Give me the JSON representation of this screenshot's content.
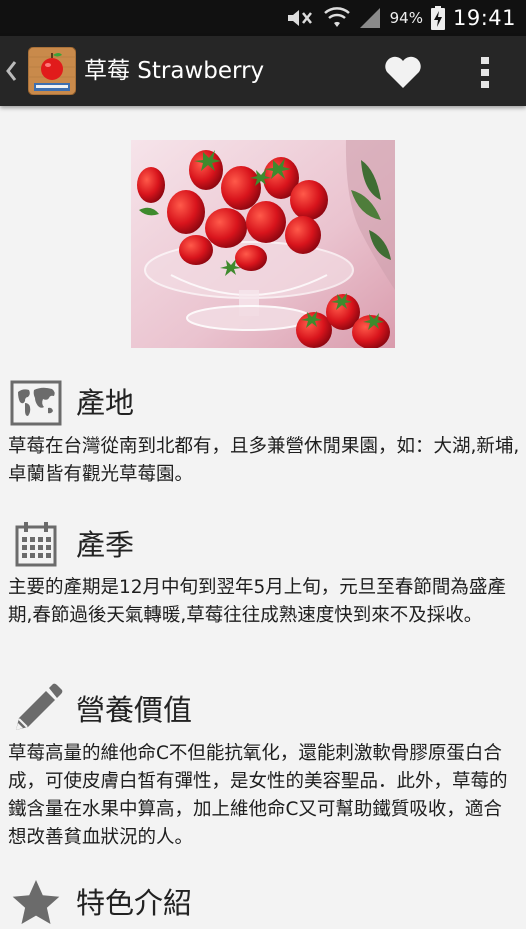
{
  "status_bar": {
    "battery_percent": "94%",
    "time": "19:41",
    "icons": [
      "mute-icon",
      "wifi-icon",
      "signal-icon",
      "battery-charging-icon"
    ]
  },
  "action_bar": {
    "title": "草莓 Strawberry",
    "icons": [
      "back-icon",
      "apple-book-app-icon",
      "heart-icon",
      "overflow-menu-icon"
    ]
  },
  "sections": [
    {
      "icon": "world-map-icon",
      "title": "產地",
      "body": "草莓在台灣從南到北都有，且多兼營休閒果園，如：大湖,新埔,卓蘭皆有觀光草莓園。"
    },
    {
      "icon": "calendar-icon",
      "title": "產季",
      "body": "主要的產期是12月中旬到翌年5月上旬，元旦至春節間為盛產期,春節過後天氣轉暖,草莓往往成熟速度快到來不及採收。"
    },
    {
      "icon": "pencil-icon",
      "title": "營養價值",
      "body": "草莓高量的維他命C不但能抗氧化，還能刺激軟骨膠原蛋白合成，可使皮膚白皙有彈性，是女性的美容聖品．此外，草莓的鐵含量在水果中算高，加上維他命C又可幫助鐵質吸收，適合想改善貧血狀況的人。"
    },
    {
      "icon": "star-icon",
      "title": "特色介紹",
      "body": ""
    }
  ],
  "colors": {
    "status_bar": "#111111",
    "action_bar": "#262626",
    "background": "#f3f3f3",
    "icon_gray": "#6b6b6b"
  }
}
